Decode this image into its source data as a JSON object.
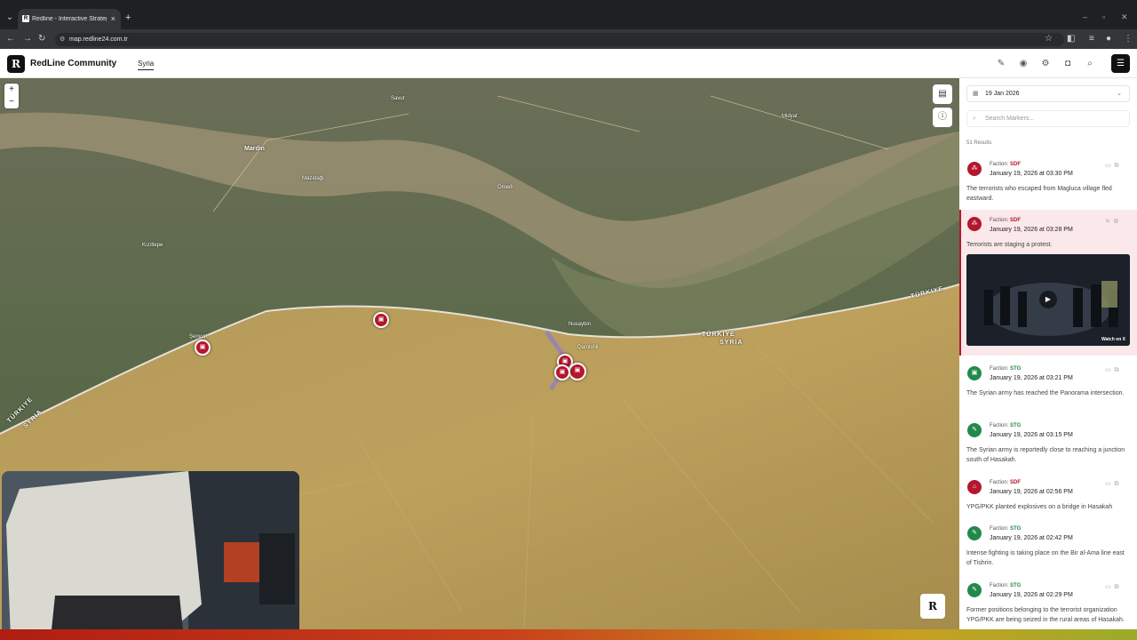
{
  "browser": {
    "tab_title": "Redline - Interactive Strategic M",
    "tab_favicon": "R",
    "url": "map.redline24.com.tr",
    "new_tab": "+",
    "close_tab": "×"
  },
  "header": {
    "logo_letter": "R",
    "brand": "RedLine Community",
    "tab": "Syria",
    "icons": [
      "layers-pen-icon",
      "pin-icon",
      "gear-icon",
      "camera-icon",
      "search-icon"
    ]
  },
  "map": {
    "zoom_in": "+",
    "zoom_out": "−",
    "labels": [
      {
        "text": "Mardin"
      },
      {
        "text": "Kızıltepe"
      },
      {
        "text": "Nusaybin"
      },
      {
        "text": "Mazıdağı"
      },
      {
        "text": "Ömerli"
      },
      {
        "text": "Midyat"
      },
      {
        "text": "Savur"
      },
      {
        "text": "Qamishli"
      },
      {
        "text": "Şenyurt"
      }
    ],
    "border_labels": {
      "turkiye_east": "TÜRKIYE",
      "turkiye_center": "TÜRKIYE",
      "syria_center": "SYRIA",
      "turkiye_west": "TÜRKIYE",
      "syria_west": "SYRIA"
    },
    "logo": "R"
  },
  "panel": {
    "date": "19 Jan 2026",
    "search_placeholder": "Search Markers...",
    "results": "51 Results",
    "items": [
      {
        "faction_label": "Faction:",
        "faction": "SDF",
        "time": "January 19, 2026 at 03:30 PM",
        "desc": "The terrorists who escaped from Magluca village fled eastward.",
        "color": "#b3172e"
      },
      {
        "faction_label": "Faction:",
        "faction": "SDF",
        "time": "January 19, 2026 at 03:28 PM",
        "desc": "Terrorists are staging a protest.",
        "color": "#b3172e",
        "video_label": "Watch on X"
      },
      {
        "faction_label": "Faction:",
        "faction": "STG",
        "time": "January 19, 2026 at 03:21 PM",
        "desc": "The Syrian army has reached the Panorama intersection.",
        "color": "#23894a"
      },
      {
        "faction_label": "Faction:",
        "faction": "STG",
        "time": "January 19, 2026 at 03:15 PM",
        "desc": "The Syrian army is reportedly close to reaching a junction south of Hasakah.",
        "color": "#23894a"
      },
      {
        "faction_label": "Faction:",
        "faction": "SDF",
        "time": "January 19, 2026 at 02:56 PM",
        "desc": "YPG/PKK planted explosives on a bridge in Hasakah",
        "color": "#b3172e"
      },
      {
        "faction_label": "Faction:",
        "faction": "STG",
        "time": "January 19, 2026 at 02:42 PM",
        "desc": "Intense fighting is taking place on the Bir al-Ama line east of Tishrin.",
        "color": "#23894a"
      },
      {
        "faction_label": "Faction:",
        "faction": "STG",
        "time": "January 19, 2026 at 02:29 PM",
        "desc": "Former positions belonging to the terrorist organization YPG/PKK are being seized in the rural areas of Hasakah.",
        "color": "#23894a"
      }
    ]
  }
}
